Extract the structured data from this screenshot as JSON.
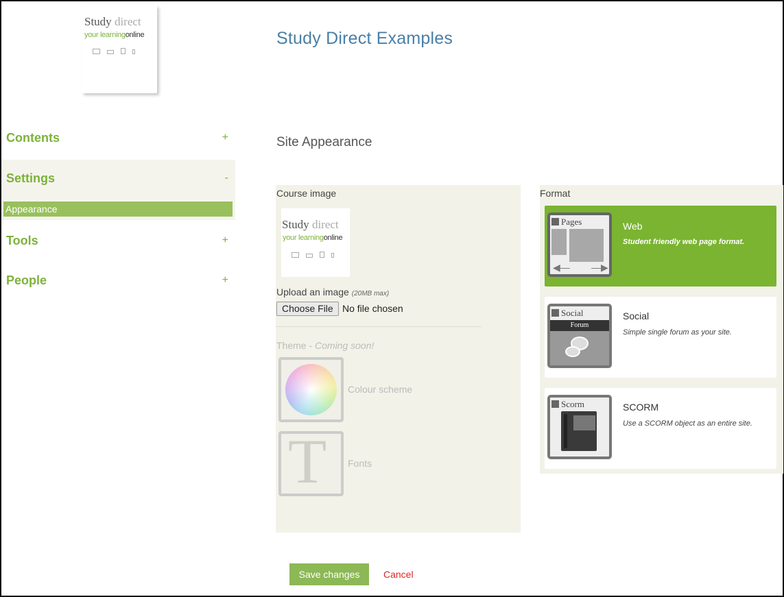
{
  "logo": {
    "study": "Study",
    "direct": "direct",
    "tagline_1": "your learning",
    "tagline_2": "online"
  },
  "site_title": "Study Direct Examples",
  "sidebar": {
    "items": [
      {
        "label": "Contents",
        "sign": "+"
      },
      {
        "label": "Settings",
        "sign": "-",
        "subitems": [
          {
            "label": "Appearance",
            "active": true
          }
        ]
      },
      {
        "label": "Tools",
        "sign": "+"
      },
      {
        "label": "People",
        "sign": "+"
      }
    ]
  },
  "section_title": "Site Appearance",
  "course_image": {
    "label": "Course image",
    "upload_label": "Upload an image",
    "upload_hint": "(20MB max)",
    "choose_button": "Choose File",
    "file_status": "No file chosen"
  },
  "theme": {
    "label": "Theme -",
    "coming_soon": "Coming soon!",
    "options": [
      {
        "label": "Colour scheme",
        "icon": "colour-wheel-icon"
      },
      {
        "label": "Fonts",
        "icon": "letter-t-icon"
      }
    ]
  },
  "format": {
    "label": "Format",
    "options": [
      {
        "thumb": "Pages",
        "title": "Web",
        "desc": "Student friendly web page format.",
        "selected": true
      },
      {
        "thumb": "Social",
        "thumb_bar": "Forum",
        "title": "Social",
        "desc": "Simple single forum as your site.",
        "selected": false
      },
      {
        "thumb": "Scorm",
        "title": "SCORM",
        "desc": "Use a SCORM object as an entire site.",
        "selected": false
      }
    ]
  },
  "actions": {
    "save": "Save changes",
    "cancel": "Cancel"
  },
  "colors": {
    "accent_green": "#7ab431",
    "title_blue": "#4a7fa6",
    "cancel_red": "#e02424"
  }
}
